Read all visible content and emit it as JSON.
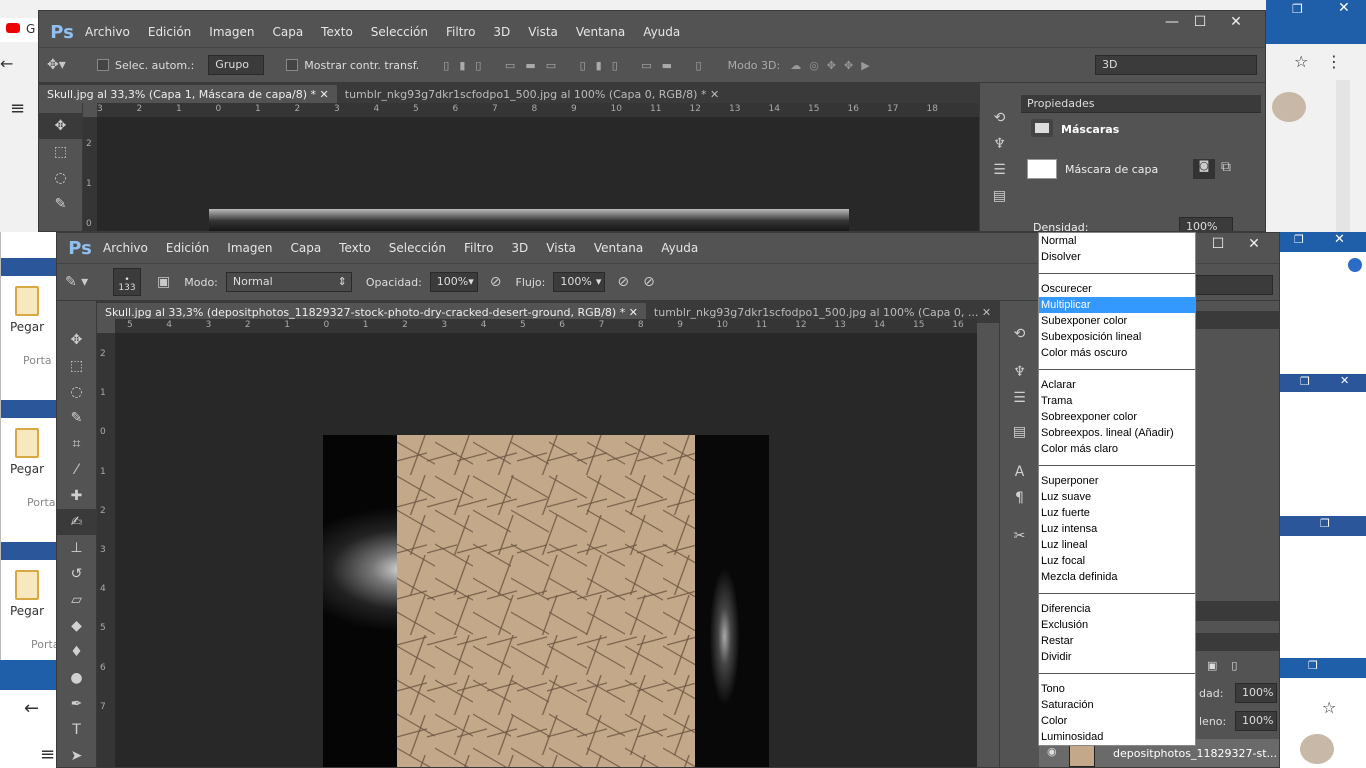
{
  "colors": {
    "ps_bg": "#535353",
    "canvas": "#282828",
    "highlight": "#3399ff",
    "ps_logo": "#8fc0f0"
  },
  "bg_browser": {
    "tab_title": "G",
    "office_paste_label": "Pegar",
    "office_porta_label": "Porta"
  },
  "back_window": {
    "logo": "Ps",
    "menu": [
      "Archivo",
      "Edición",
      "Imagen",
      "Capa",
      "Texto",
      "Selección",
      "Filtro",
      "3D",
      "Vista",
      "Ventana",
      "Ayuda"
    ],
    "options": {
      "auto_select_label": "Selec. autom.:",
      "auto_select_value": "Grupo",
      "show_transform_label": "Mostrar contr. transf.",
      "mode3d_label": "Modo 3D:",
      "mode3d_value": "3D"
    },
    "tabs": [
      "Skull.jpg al 33,3% (Capa 1, Máscara de capa/8) *",
      "tumblr_nkg93g7dkr1scfodpo1_500.jpg al 100% (Capa 0, RGB/8) *"
    ],
    "ruler_top": [
      "3",
      "2",
      "1",
      "0",
      "1",
      "2",
      "3",
      "4",
      "5",
      "6",
      "7",
      "8",
      "9",
      "10",
      "11",
      "12",
      "13",
      "14",
      "15",
      "16",
      "17",
      "18"
    ],
    "ruler_left": [
      "2",
      "1",
      "0"
    ],
    "properties": {
      "title": "Propiedades",
      "section": "Máscaras",
      "mask_label": "Máscara de capa",
      "density_label": "Densidad:",
      "density_value": "100%"
    }
  },
  "front_window": {
    "logo": "Ps",
    "menu": [
      "Archivo",
      "Edición",
      "Imagen",
      "Capa",
      "Texto",
      "Selección",
      "Filtro",
      "3D",
      "Vista",
      "Ventana",
      "Ayuda"
    ],
    "options": {
      "brush_size": "133",
      "mode_label": "Modo:",
      "mode_value": "Normal",
      "opacity_label": "Opacidad:",
      "opacity_value": "100%",
      "flow_label": "Flujo:",
      "flow_value": "100%"
    },
    "tabs": [
      "Skull.jpg al 33,3% (depositphotos_11829327-stock-photo-dry-cracked-desert-ground, RGB/8) *",
      "tumblr_nkg93g7dkr1scfodpo1_500.jpg al 100% (Capa 0, ..."
    ],
    "ruler_top": [
      "5",
      "4",
      "3",
      "2",
      "1",
      "0",
      "1",
      "2",
      "3",
      "4",
      "5",
      "6",
      "7",
      "8",
      "9",
      "10",
      "11",
      "12",
      "13",
      "14",
      "15",
      "16"
    ],
    "ruler_left": [
      "2",
      "1",
      "0",
      "1",
      "2",
      "3",
      "4",
      "5",
      "6",
      "7"
    ],
    "layers": {
      "opacity_label": "dad:",
      "opacity_value": "100%",
      "fill_label": "leno:",
      "fill_value": "100%",
      "layer_name": "depositphotos_11829327-st..."
    }
  },
  "blend_modes": {
    "selected": "Multiplicar",
    "groups": [
      [
        "Normal",
        "Disolver"
      ],
      [
        "Oscurecer",
        "Multiplicar",
        "Subexponer color",
        "Subexposición lineal",
        "Color más oscuro"
      ],
      [
        "Aclarar",
        "Trama",
        "Sobreexponer color",
        "Sobreexpos. lineal (Añadir)",
        "Color más claro"
      ],
      [
        "Superponer",
        "Luz suave",
        "Luz fuerte",
        "Luz intensa",
        "Luz lineal",
        "Luz focal",
        "Mezcla definida"
      ],
      [
        "Diferencia",
        "Exclusión",
        "Restar",
        "Dividir"
      ],
      [
        "Tono",
        "Saturación",
        "Color",
        "Luminosidad"
      ]
    ]
  }
}
